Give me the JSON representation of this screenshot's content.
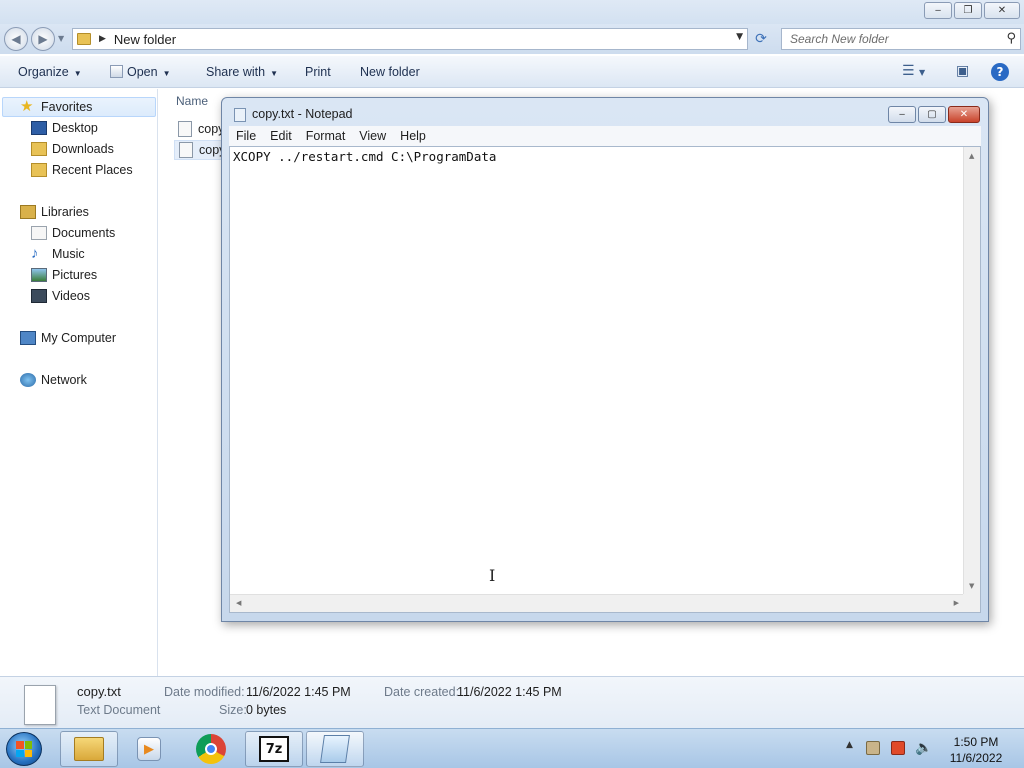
{
  "explorer": {
    "window_controls": {
      "minimize": "‒",
      "restore": "❐",
      "close": "✕"
    },
    "address": {
      "path": "New folder"
    },
    "search": {
      "placeholder": "Search New folder"
    },
    "commands": {
      "organize": "Organize",
      "open": "Open",
      "share_with": "Share with",
      "print": "Print",
      "new_folder": "New folder"
    },
    "nav": {
      "favorites": "Favorites",
      "desktop": "Desktop",
      "downloads": "Downloads",
      "recent_places": "Recent Places",
      "libraries": "Libraries",
      "documents": "Documents",
      "music": "Music",
      "pictures": "Pictures",
      "videos": "Videos",
      "my_computer": "My Computer",
      "network": "Network"
    },
    "column_name": "Name",
    "files": [
      {
        "name": "copy"
      },
      {
        "name": "copy"
      }
    ],
    "details": {
      "file_name": "copy.txt",
      "file_type": "Text Document",
      "date_modified_label": "Date modified:",
      "date_modified": "11/6/2022 1:45 PM",
      "date_created_label": "Date created:",
      "date_created": "11/6/2022 1:45 PM",
      "size_label": "Size:",
      "size": "0 bytes"
    }
  },
  "notepad": {
    "title": "copy.txt - Notepad",
    "menu": [
      "File",
      "Edit",
      "Format",
      "View",
      "Help"
    ],
    "content": "XCOPY ../restart.cmd C:\\ProgramData"
  },
  "taskbar": {
    "apps": [
      "windows-explorer",
      "media-player",
      "chrome",
      "7-zip",
      "notepad"
    ],
    "clock_time": "1:50 PM",
    "clock_date": "11/6/2022"
  }
}
